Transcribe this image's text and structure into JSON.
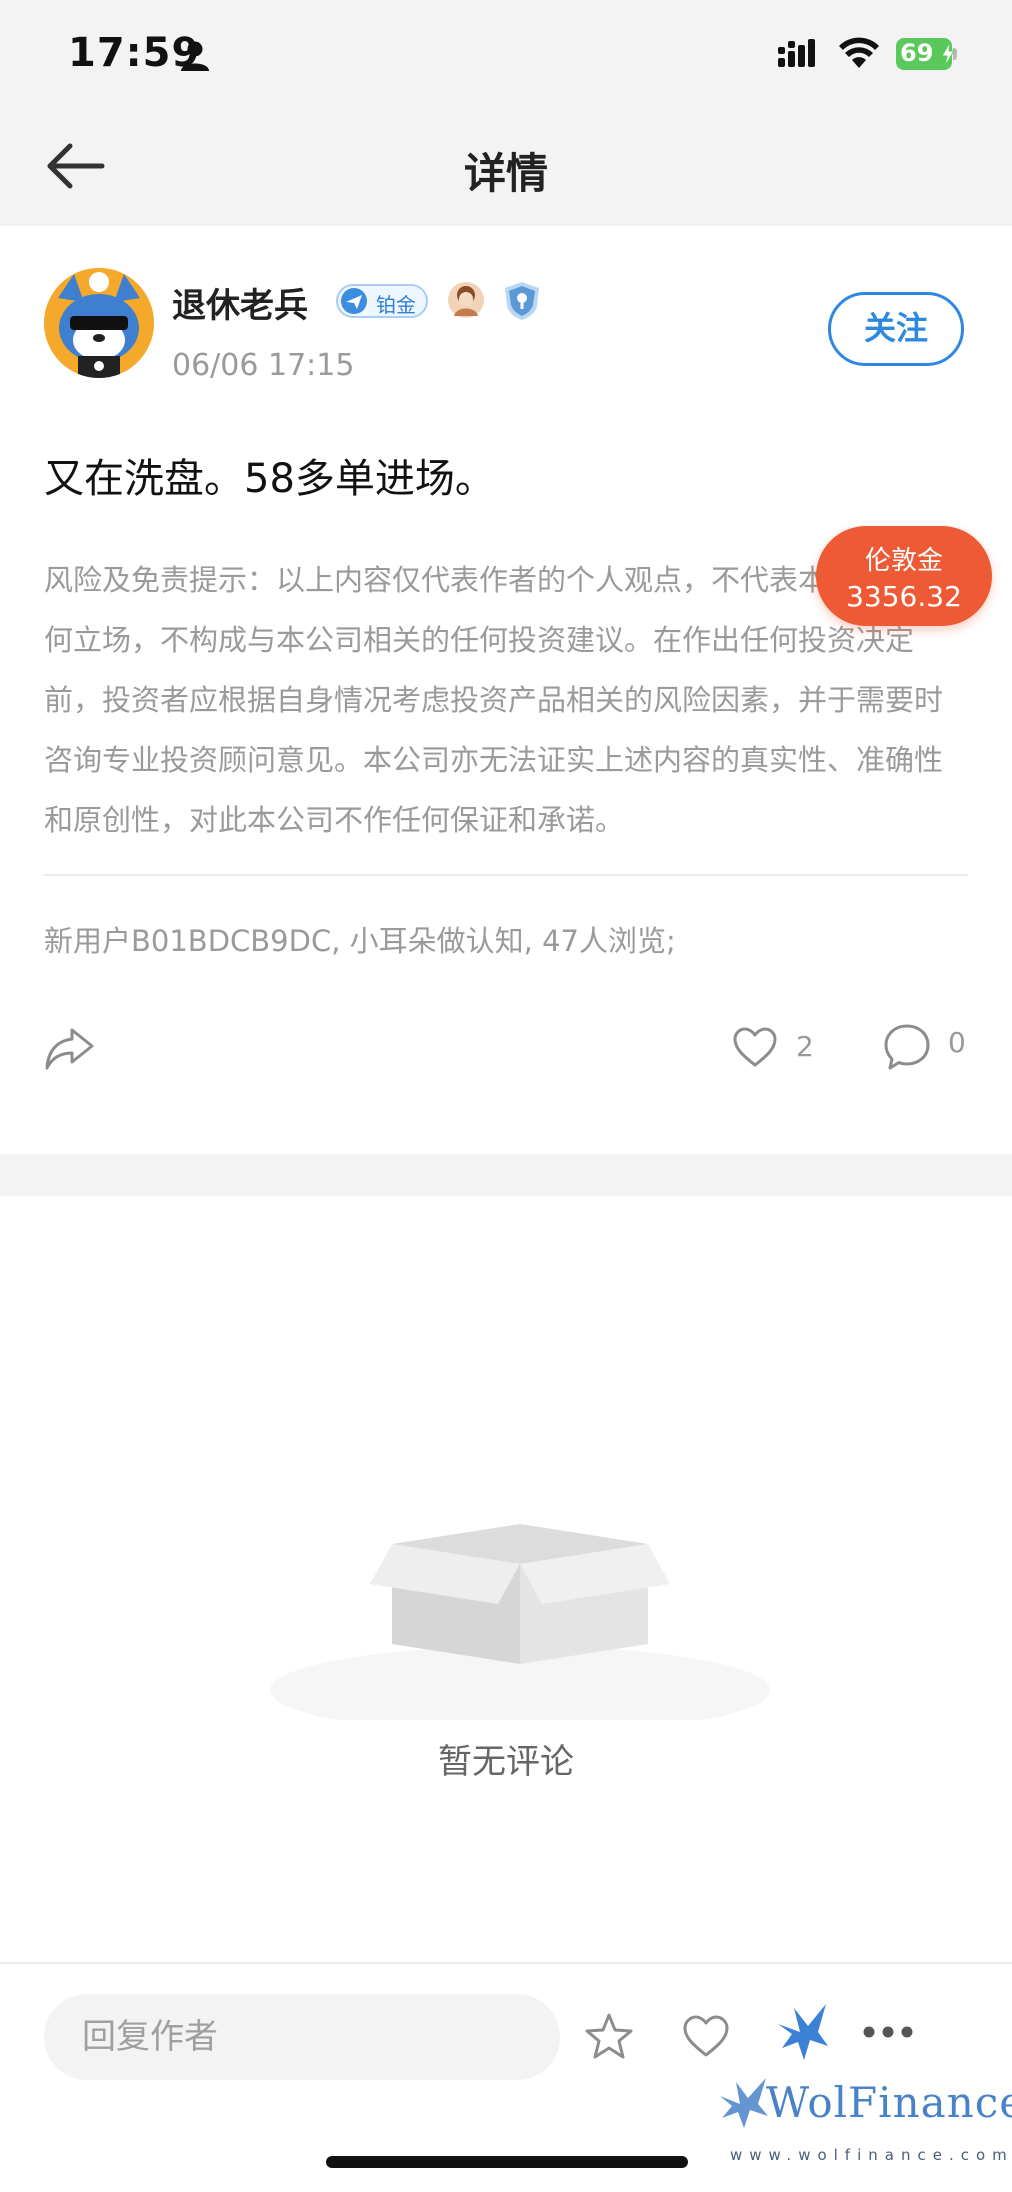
{
  "status_bar": {
    "time": "17:59",
    "battery_percent": "69",
    "battery_color": "#5ac85a",
    "icons": [
      "person-icon",
      "signal-icon",
      "wifi-icon",
      "battery-icon",
      "charging-bolt-icon"
    ]
  },
  "nav": {
    "title": "详情",
    "back_icon": "arrow-left-icon"
  },
  "post": {
    "author": {
      "name": "退休老兵",
      "tier_label": "铂金",
      "avatar_icon": "wolf-mascot-avatar"
    },
    "time": "06/06 17:15",
    "follow_label": "关注",
    "content": "又在洗盘。58多单进场。",
    "disclaimer": "风险及免责提示：以上内容仅代表作者的个人观点，不代表本公司的任何立场，不构成与本公司相关的任何投资建议。在作出任何投资决定前，投资者应根据自身情况考虑投资产品相关的风险因素，并于需要时咨询专业投资顾问意见。本公司亦无法证实上述内容的真实性、准确性和原创性，对此本公司不作任何保证和承诺。",
    "viewers": "新用户B01BDCB9DC, 小耳朵做认知, 47人浏览;",
    "likes": "2",
    "comments": "0"
  },
  "price_badge": {
    "label": "伦敦金",
    "value": "3356.32",
    "color": "#ef5a36"
  },
  "comments_section": {
    "empty_text": "暂无评论"
  },
  "bottom_bar": {
    "reply_placeholder": "回复作者"
  },
  "watermark": {
    "name": "WolFinance",
    "url": "www.wolfinance.com"
  },
  "colors": {
    "accent": "#2f88e0",
    "muted_text": "#9a9a9a",
    "page_bg": "#f3f3f3"
  }
}
